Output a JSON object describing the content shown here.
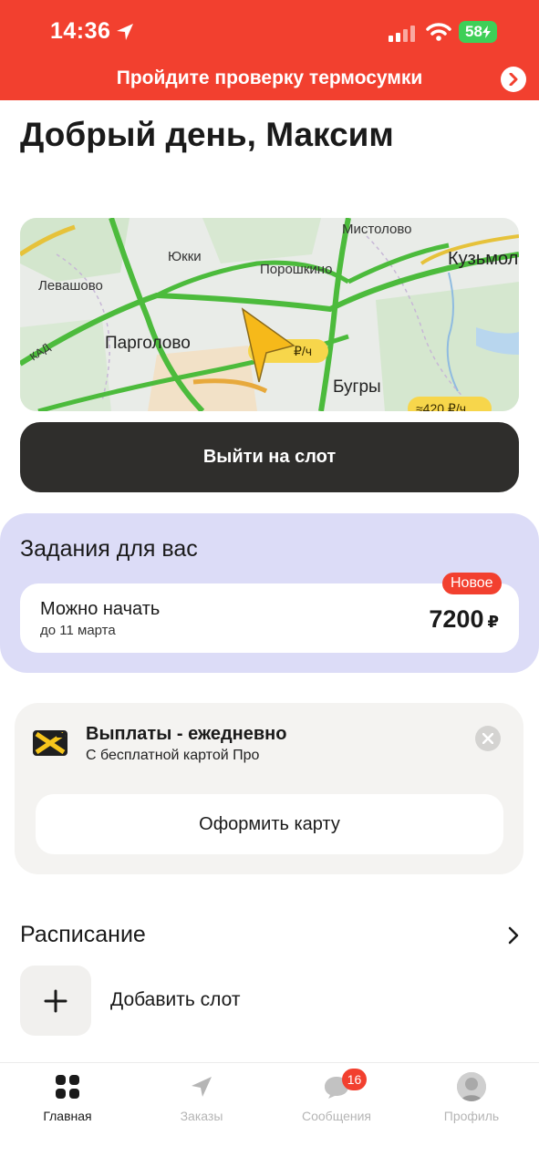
{
  "status_bar": {
    "time": "14:36",
    "battery": "58"
  },
  "banner": {
    "text": "Пройдите проверку термосумки"
  },
  "greeting": "Добрый день, Максим",
  "map": {
    "labels": {
      "mistolovo": "Мистолово",
      "yukki": "Юкки",
      "poroshkino": "Порошкино",
      "kuzmolovo": "Кузьмол",
      "levashovo": "Левашово",
      "pargolovo": "Парголово",
      "kad": "КАД",
      "bugry": "Бугры",
      "rate_a": "₽/ч",
      "rate_b": "≈420 ₽/ч"
    }
  },
  "slot_button": {
    "label": "Выйти на слот"
  },
  "tasks": {
    "title": "Задания для вас",
    "badge": "Новое",
    "card": {
      "title": "Можно начать",
      "subtitle": "до 11 марта",
      "price": "7200",
      "currency": "₽"
    }
  },
  "payments": {
    "title": "Выплаты - ежедневно",
    "subtitle": "С бесплатной картой Про",
    "button": "Оформить карту"
  },
  "schedule": {
    "title": "Расписание",
    "add_label": "Добавить слот"
  },
  "tabbar": {
    "items": [
      {
        "label": "Главная",
        "icon": "grid-icon",
        "active": true
      },
      {
        "label": "Заказы",
        "icon": "navigation-arrow-icon",
        "active": false
      },
      {
        "label": "Сообщения",
        "icon": "chat-bubble-icon",
        "active": false,
        "badge": "16"
      },
      {
        "label": "Профиль",
        "icon": "avatar",
        "active": false
      }
    ]
  },
  "colors": {
    "brand_red": "#f2402f",
    "dark_button": "#2f2e2c",
    "tasks_bg": "#dcdcf7",
    "traffic_green": "#4cbb3c",
    "battery_green": "#3ecf57"
  }
}
